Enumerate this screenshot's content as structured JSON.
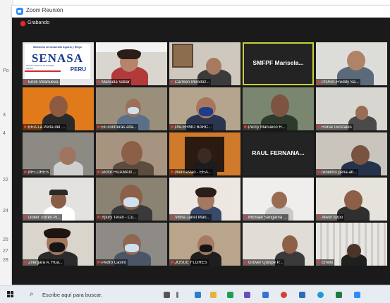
{
  "window": {
    "title": "Zoom Reunión"
  },
  "recording": {
    "label": "Grabando",
    "color": "#e22b2b"
  },
  "doc_marks": [
    "Po",
    "3",
    "4",
    "22",
    "24",
    "25",
    "27",
    "28"
  ],
  "active_speaker_color": "#c5d334",
  "tiles": [
    {
      "label": "Erick Villanueva",
      "kind": "logo"
    },
    {
      "label": "Marisela Vabar",
      "kind": "person"
    },
    {
      "label": "Carmen Mendoz...",
      "kind": "person"
    },
    {
      "label": "",
      "big_name": "SMFPF  Marisela...",
      "kind": "name",
      "active": true
    },
    {
      "label": "PIURA-Freddy Sa...",
      "kind": "person"
    },
    {
      "label": "EEA La Perla del ...",
      "kind": "person"
    },
    {
      "label": "Eli contreras alfa...",
      "kind": "person"
    },
    {
      "label": "PALERMO BARC...",
      "kind": "person"
    },
    {
      "label": "Percy Mañueco R...",
      "kind": "person"
    },
    {
      "label": "Ronal Gonzales",
      "kind": "person"
    },
    {
      "label": "MFLORES",
      "kind": "person"
    },
    {
      "label": "Victor HUAMAN ...",
      "kind": "person"
    },
    {
      "label": "Wenceslao - EEA...",
      "kind": "person"
    },
    {
      "label": "",
      "big_name": "RAUL FERNANA...",
      "kind": "name"
    },
    {
      "label": "renelmo peña-ab...",
      "kind": "person"
    },
    {
      "label": "Doiler  Torres Pi...",
      "kind": "person"
    },
    {
      "label": "Ypury Teran - Cu...",
      "kind": "person"
    },
    {
      "label": "Vilma Janet Mari...",
      "kind": "person"
    },
    {
      "label": "Michael Sangama ...",
      "kind": "person"
    },
    {
      "label": "Aliver turpo",
      "kind": "person"
    },
    {
      "label": "Zvergara A. Hua...",
      "kind": "person"
    },
    {
      "label": "Pedro Castro",
      "kind": "person"
    },
    {
      "label": "JOSUE FLORES",
      "kind": "person"
    },
    {
      "label": "Grover Quispe P...",
      "kind": "person"
    },
    {
      "label": "Emilio",
      "kind": "person"
    }
  ],
  "logo": {
    "top_text": "Ministerio de Desarrollo Agrario y Riego",
    "main_text": "SENASA",
    "sub_text": "Servicio Nacional de Sanidad Agraria",
    "country": "PERU"
  },
  "taskbar": {
    "search_placeholder": "Escribe aquí para buscar.",
    "search_icon": "search-icon",
    "windows_icon": "windows-start-icon"
  }
}
